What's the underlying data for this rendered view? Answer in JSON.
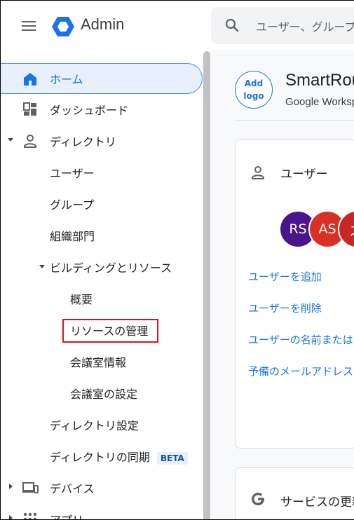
{
  "header": {
    "brand": "Admin",
    "search_placeholder": "ユーザー、グループ、設定を検索"
  },
  "sidebar": {
    "home": "ホーム",
    "dashboard": "ダッシュボード",
    "directory": "ディレクトリ",
    "users": "ユーザー",
    "groups": "グループ",
    "org_units": "組織部門",
    "buildings": "ビルディングとリソース",
    "overview": "概要",
    "resource_mgmt": "リソースの管理",
    "room_info": "会議室情報",
    "room_settings": "会議室の設定",
    "directory_settings": "ディレクトリ設定",
    "directory_sync": "ディレクトリの同期",
    "beta": "BETA",
    "devices": "デバイス",
    "apps": "アプリ"
  },
  "main": {
    "add_logo": [
      "Add",
      "logo"
    ],
    "org_name": "SmartRound",
    "org_sub": "Google Workspace",
    "users_card": {
      "title": "ユーザー",
      "avatars": [
        {
          "initials": "RS",
          "color": "#4a148c"
        },
        {
          "initials": "AS",
          "color": "#d93025"
        },
        {
          "initials": "之",
          "color": "#c62828"
        }
      ],
      "links": [
        "ユーザーを追加",
        "ユーザーを削除",
        "ユーザーの名前または",
        "予備のメールアドレス"
      ]
    },
    "services_card": {
      "title": "サービスの更新"
    }
  }
}
